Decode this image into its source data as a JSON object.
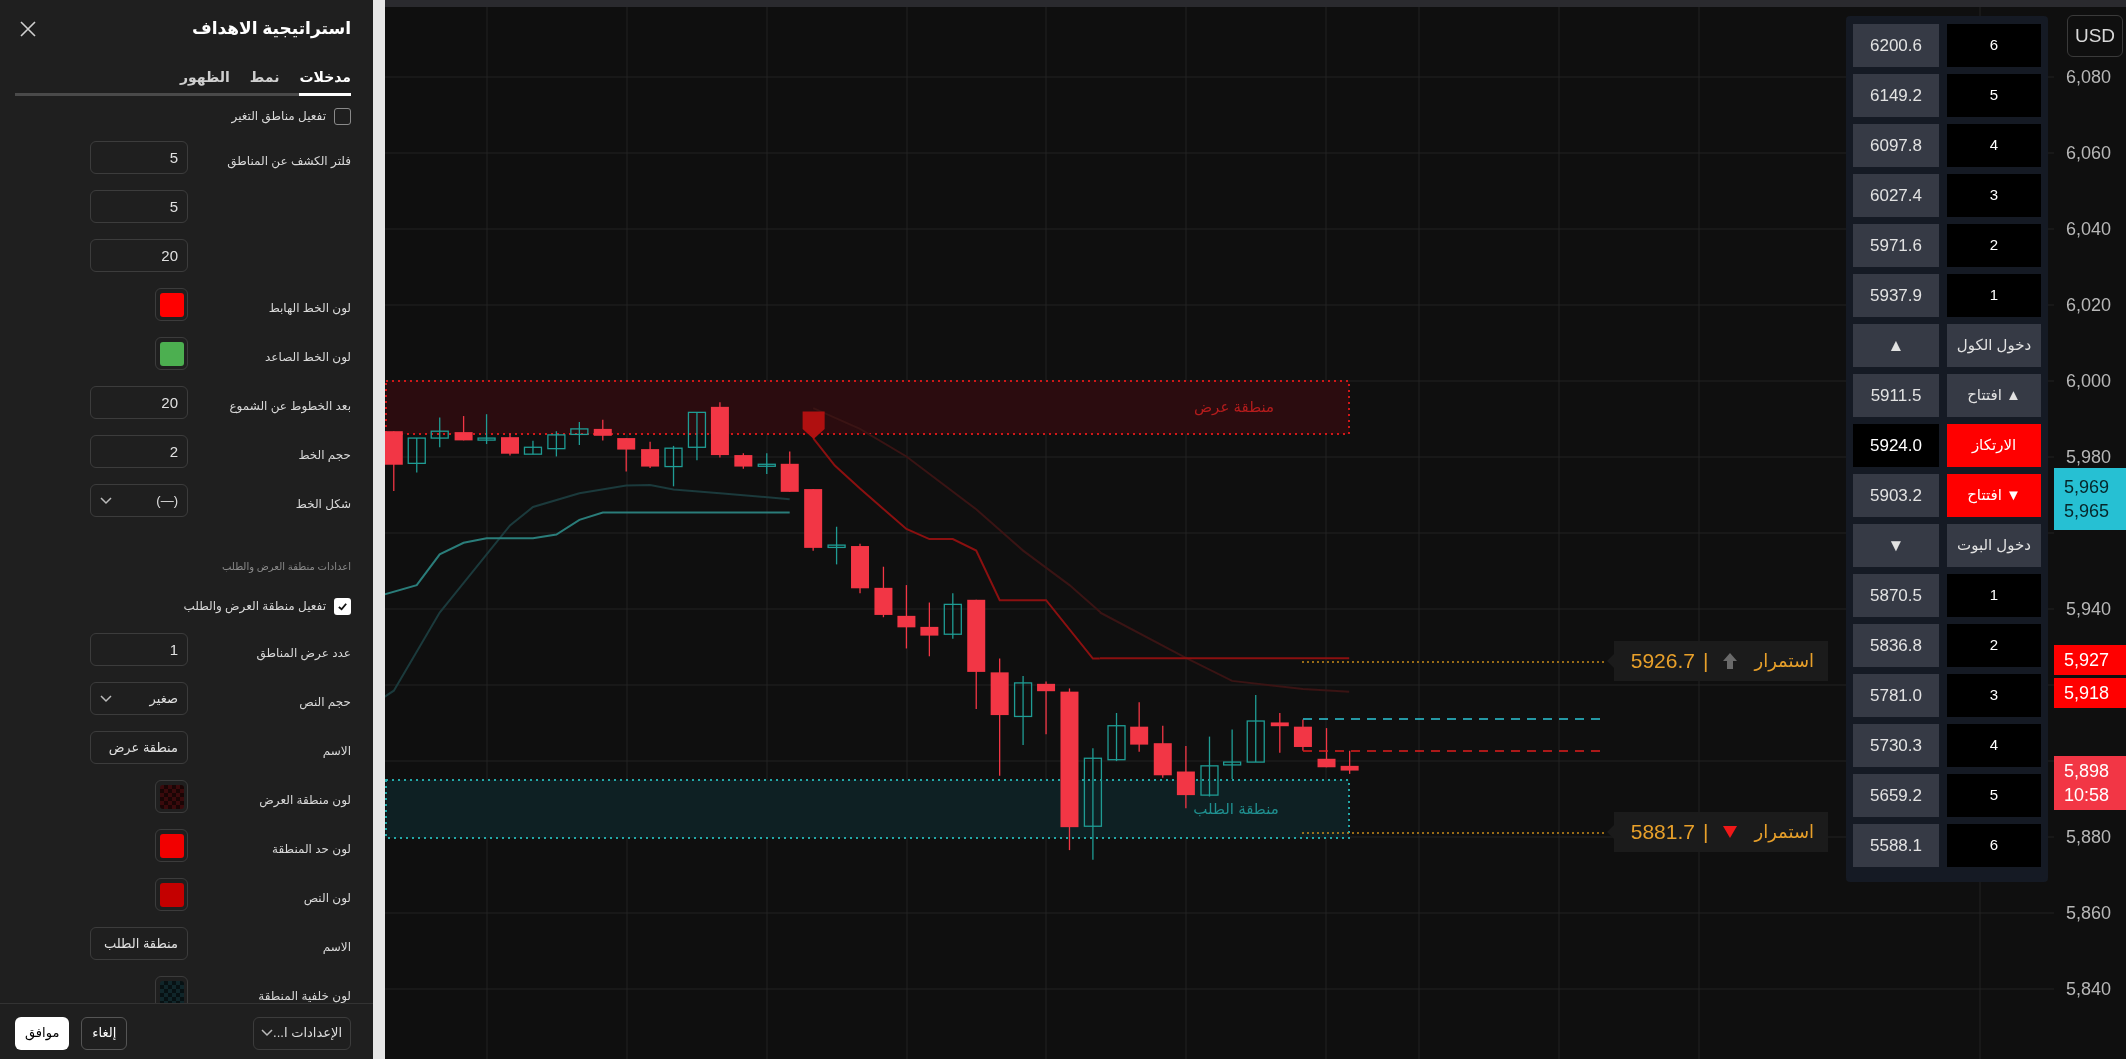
{
  "panel": {
    "title": "استراتيجية الاهداف",
    "tabs": [
      {
        "label": "مدخلات",
        "selected": true
      },
      {
        "label": "نمط",
        "selected": false
      },
      {
        "label": "الظهور",
        "selected": false
      }
    ],
    "rows": [
      {
        "kind": "checkbox",
        "label": "تفعيل مناطق التغير",
        "checked": false
      },
      {
        "kind": "number",
        "label": "فلتر الكشف عن المناطق",
        "value": "5"
      },
      {
        "kind": "number",
        "value": "5"
      },
      {
        "kind": "number",
        "value": "20"
      },
      {
        "kind": "color",
        "label": "لون الخط الهابط",
        "color": "#ff0000"
      },
      {
        "kind": "color",
        "label": "لون الخط الصاعد",
        "color": "#4caf50"
      },
      {
        "kind": "number",
        "label": "بعد الخطوط عن الشموع",
        "value": "20"
      },
      {
        "kind": "number",
        "label": "حجم الخط",
        "value": "2"
      },
      {
        "kind": "select",
        "label": "شكل الخط",
        "value": "(—)"
      },
      {
        "kind": "heading",
        "label": "اعدادات منطقة العرض والطلب"
      },
      {
        "kind": "checkbox",
        "label": "تفعيل منطقة العرض والطلب",
        "checked": true
      },
      {
        "kind": "number",
        "label": "عدد عرض المناطق",
        "value": "1"
      },
      {
        "kind": "select",
        "label": "حجم النص",
        "value": "صغير"
      },
      {
        "kind": "text",
        "label": "الاسم",
        "value": "منطقة عرض"
      },
      {
        "kind": "color",
        "label": "لون منطقة العرض",
        "color": "#3a0a0c",
        "checker": true
      },
      {
        "kind": "color",
        "label": "لون حد المنطقة",
        "color": "#f20000"
      },
      {
        "kind": "color",
        "label": "لون النص",
        "color": "#c40000"
      },
      {
        "kind": "text",
        "label": "الاسم",
        "value": "منطقة الطلب"
      },
      {
        "kind": "color",
        "label": "لون خلفية المنطقة",
        "color": "#10262a",
        "checker": true
      }
    ],
    "footer": {
      "preset": "الإعدادات ا...",
      "cancel": "إلغاء",
      "ok": "موافق"
    }
  },
  "chart": {
    "supply_zone": "منطقة عرض",
    "demand_zone": "منطقة الطلب",
    "labels": [
      {
        "text": "استمرار",
        "value": "5926.7",
        "separator": "|",
        "kind": "up"
      },
      {
        "text": "استمرار",
        "value": "5881.7",
        "separator": "|",
        "kind": "down"
      }
    ],
    "currency": "USD",
    "axis": [
      "6,080",
      "6,060",
      "6,040",
      "6,020",
      "6,000",
      "5,980",
      "5,940",
      "5,880",
      "5,860",
      "5,840"
    ],
    "tags": [
      {
        "lines": [
          "5,969",
          "5,965"
        ],
        "kind": "cyan"
      },
      {
        "lines": [
          "5,927"
        ],
        "kind": "red"
      },
      {
        "lines": [
          "5,918"
        ],
        "kind": "red"
      },
      {
        "lines": [
          "5,898",
          "10:58"
        ],
        "kind": "pink"
      }
    ]
  },
  "levels_table": {
    "rows": [
      {
        "cells": [
          {
            "text": "6",
            "kind": "black"
          },
          {
            "text": "6200.6",
            "kind": "gray"
          }
        ]
      },
      {
        "cells": [
          {
            "text": "5",
            "kind": "black"
          },
          {
            "text": "6149.2",
            "kind": "gray"
          }
        ]
      },
      {
        "cells": [
          {
            "text": "4",
            "kind": "black"
          },
          {
            "text": "6097.8",
            "kind": "gray"
          }
        ]
      },
      {
        "cells": [
          {
            "text": "3",
            "kind": "black"
          },
          {
            "text": "6027.4",
            "kind": "gray"
          }
        ]
      },
      {
        "cells": [
          {
            "text": "2",
            "kind": "black"
          },
          {
            "text": "5971.6",
            "kind": "gray"
          }
        ]
      },
      {
        "cells": [
          {
            "text": "1",
            "kind": "black"
          },
          {
            "text": "5937.9",
            "kind": "gray"
          }
        ]
      },
      {
        "cells": [
          {
            "text": "دخول الكول",
            "kind": "gray"
          },
          {
            "text": "▲",
            "kind": "gray"
          }
        ]
      },
      {
        "cells": [
          {
            "text": "▲ افتتاح",
            "kind": "gray"
          },
          {
            "text": "5911.5",
            "kind": "gray"
          }
        ]
      },
      {
        "cells": [
          {
            "text": "الارتكاز",
            "kind": "red"
          },
          {
            "text": "5924.0",
            "kind": "black"
          }
        ]
      },
      {
        "cells": [
          {
            "text": "▼ افتتاح",
            "kind": "red"
          },
          {
            "text": "5903.2",
            "kind": "gray"
          }
        ]
      },
      {
        "cells": [
          {
            "text": "دخول البوت",
            "kind": "gray"
          },
          {
            "text": "▼",
            "kind": "gray"
          }
        ]
      },
      {
        "cells": [
          {
            "text": "1",
            "kind": "black"
          },
          {
            "text": "5870.5",
            "kind": "gray"
          }
        ]
      },
      {
        "cells": [
          {
            "text": "2",
            "kind": "black"
          },
          {
            "text": "5836.8",
            "kind": "gray"
          }
        ]
      },
      {
        "cells": [
          {
            "text": "3",
            "kind": "black"
          },
          {
            "text": "5781.0",
            "kind": "gray"
          }
        ]
      },
      {
        "cells": [
          {
            "text": "4",
            "kind": "black"
          },
          {
            "text": "5730.3",
            "kind": "gray"
          }
        ]
      },
      {
        "cells": [
          {
            "text": "5",
            "kind": "black"
          },
          {
            "text": "5659.2",
            "kind": "gray"
          }
        ]
      },
      {
        "cells": [
          {
            "text": "6",
            "kind": "black"
          },
          {
            "text": "5588.1",
            "kind": "gray"
          }
        ]
      }
    ]
  }
}
